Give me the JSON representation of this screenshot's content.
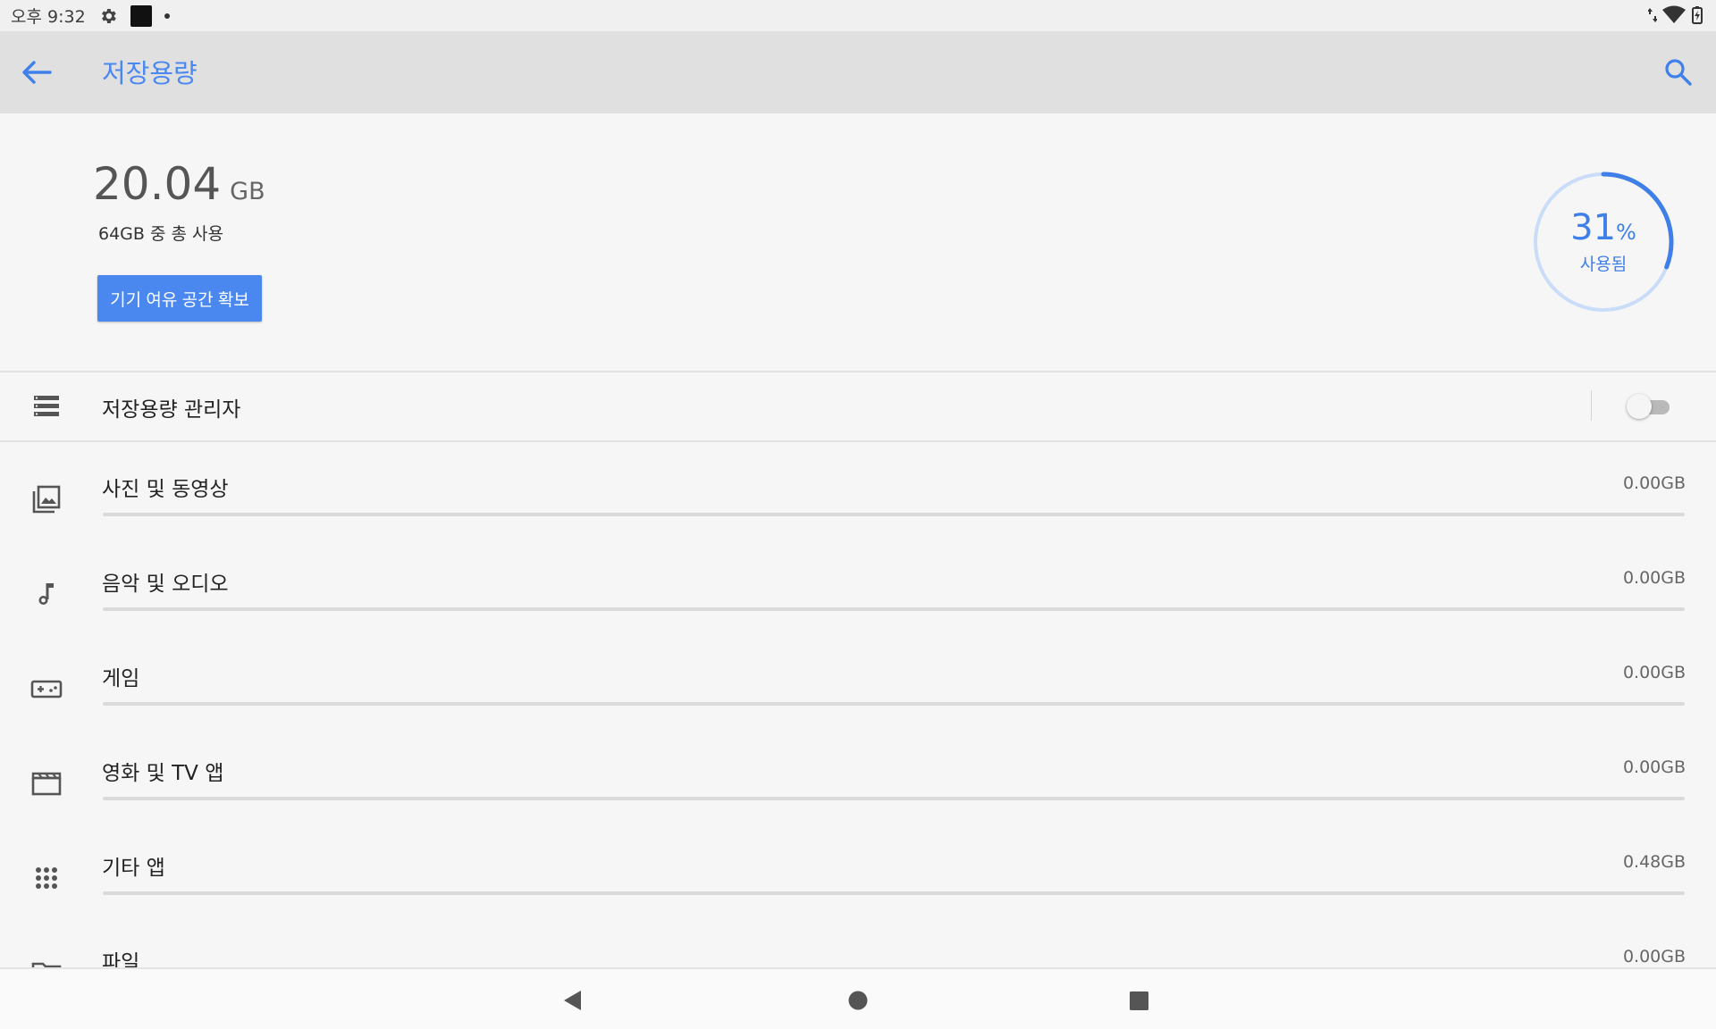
{
  "status_bar": {
    "time": "오후 9:32",
    "icons": [
      "gear-icon",
      "notification-square-icon",
      "dot-icon",
      "data-arrows-icon",
      "wifi-icon",
      "battery-icon"
    ]
  },
  "app_bar": {
    "title": "저장용량",
    "back_icon": "arrow-back-icon",
    "search_icon": "search-icon"
  },
  "summary": {
    "used_value": "20.04",
    "used_unit": "GB",
    "used_sub": "64GB 중 총 사용",
    "free_button": "기기 여유 공간 확보",
    "percent": "31",
    "percent_symbol": "%",
    "percent_label": "사용됨",
    "percent_fraction": 0.31
  },
  "storage_manager": {
    "label": "저장용량 관리자",
    "icon": "storage-list-icon",
    "enabled": false
  },
  "categories": [
    {
      "label": "사진 및 동영상",
      "size": "0.00GB",
      "icon": "photo-library-icon",
      "fraction": 0.0
    },
    {
      "label": "음악 및 오디오",
      "size": "0.00GB",
      "icon": "music-note-icon",
      "fraction": 0.0
    },
    {
      "label": "게임",
      "size": "0.00GB",
      "icon": "gamepad-icon",
      "fraction": 0.0
    },
    {
      "label": "영화 및 TV 앱",
      "size": "0.00GB",
      "icon": "movie-icon",
      "fraction": 0.0
    },
    {
      "label": "기타 앱",
      "size": "0.48GB",
      "icon": "apps-grid-icon",
      "fraction": 0.0
    },
    {
      "label": "파일",
      "size": "0.00GB",
      "icon": "folder-icon",
      "fraction": 0.0
    }
  ],
  "colors": {
    "accent": "#4a88f0",
    "app_bar": "#e0e0e0",
    "background": "#f7f6f7",
    "ring_track": "#c9dcf8"
  },
  "nav_bar": {
    "back": "nav-back-icon",
    "home": "nav-home-icon",
    "recents": "nav-recents-icon"
  }
}
